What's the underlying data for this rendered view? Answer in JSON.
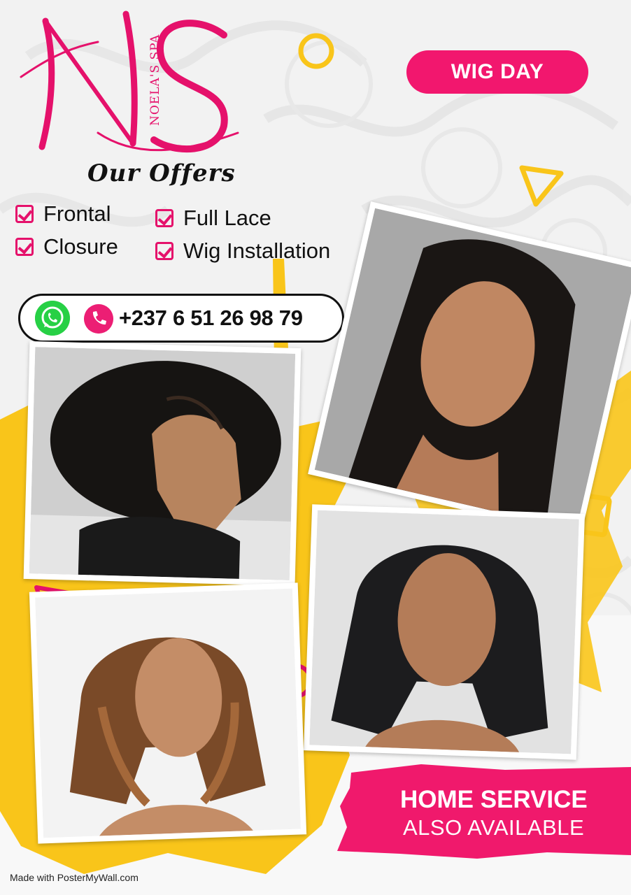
{
  "logo": {
    "monogram": "NS",
    "spa_text": "NOELA'S SPA"
  },
  "badge": {
    "label": "WIG DAY"
  },
  "offers": {
    "title": "Our Offers",
    "items": [
      "Frontal",
      "Full Lace",
      "Closure",
      "Wig Installation"
    ]
  },
  "contact": {
    "phone": "+237 6 51 26 98 79",
    "icons": [
      "whatsapp-icon",
      "phone-icon"
    ]
  },
  "home_service": {
    "line1": "HOME SERVICE",
    "line2": "ALSO AVAILABLE"
  },
  "credit": "Made with PosterMyWall.com",
  "colors": {
    "brand_pink": "#e5116b",
    "accent_yellow": "#f9c51a",
    "background": "#f1f1f1"
  }
}
